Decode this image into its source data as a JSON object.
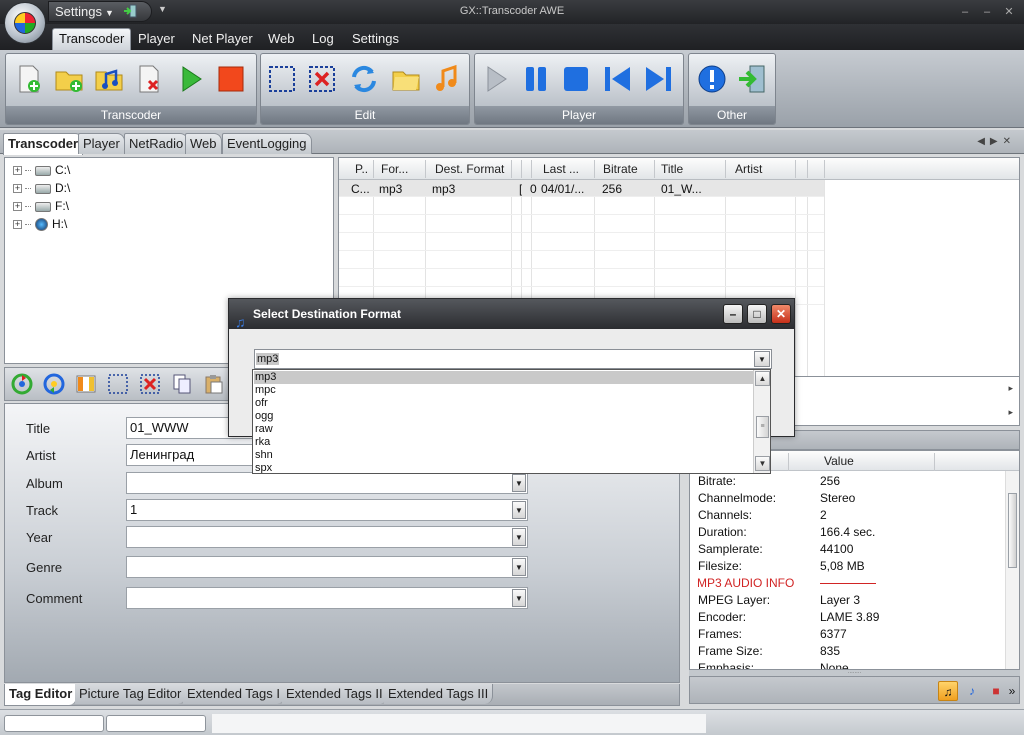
{
  "window": {
    "title": "GX::Transcoder AWE",
    "settings_label": "Settings",
    "win_buttons": [
      "–",
      "–",
      "✕"
    ]
  },
  "menu": [
    {
      "label": "Transcoder",
      "active": true
    },
    {
      "label": "Player",
      "active": false
    },
    {
      "label": "Net Player",
      "active": false
    },
    {
      "label": "Web",
      "active": false
    },
    {
      "label": "Log",
      "active": false
    },
    {
      "label": "Settings",
      "active": false
    }
  ],
  "ribbon": {
    "groups": [
      "Transcoder",
      "Edit",
      "Player",
      "Other"
    ]
  },
  "doc_tabs": [
    {
      "label": "Transcoder",
      "active": true
    },
    {
      "label": "Player",
      "active": false
    },
    {
      "label": "NetRadio",
      "active": false
    },
    {
      "label": "Web",
      "active": false
    },
    {
      "label": "EventLogging",
      "active": false
    }
  ],
  "tree": {
    "drives": [
      "C:\\",
      "D:\\",
      "F:\\",
      "H:\\"
    ]
  },
  "job_grid": {
    "columns": [
      "P..",
      "For...",
      "Dest. Format",
      "Last ...",
      "Bitrate",
      "Title",
      "Artist"
    ],
    "row": {
      "p": "C...",
      "format": "mp3",
      "dest_format": "mp3",
      "c1": "[",
      "c2": "0",
      "last": "04/01/...",
      "bitrate": "256",
      "title": "01_W..."
    }
  },
  "dialog": {
    "title": "Select Destination Format",
    "selected": "mp3",
    "options": [
      "mp3",
      "mpc",
      "ofr",
      "ogg",
      "raw",
      "rka",
      "shn",
      "spx"
    ],
    "thumb_mark": "≡"
  },
  "tag_editor": {
    "fields": [
      {
        "label": "Title",
        "value": "01_WWW"
      },
      {
        "label": "Artist",
        "value": "Ленинград"
      },
      {
        "label": "Album",
        "value": ""
      },
      {
        "label": "Track",
        "value": "1"
      },
      {
        "label": "Year",
        "value": ""
      },
      {
        "label": "Genre",
        "value": ""
      },
      {
        "label": "Comment",
        "value": ""
      }
    ],
    "tabs": [
      {
        "label": "Tag Editor",
        "active": true
      },
      {
        "label": "Picture Tag Editor",
        "active": false
      },
      {
        "label": "Extended Tags I",
        "active": false
      },
      {
        "label": "Extended Tags II",
        "active": false
      },
      {
        "label": "Extended Tags III",
        "active": false
      }
    ]
  },
  "properties": {
    "value_header": "Value",
    "rows": [
      {
        "name": "Bitrate:",
        "value": "256"
      },
      {
        "name": "Channelmode:",
        "value": "Stereo"
      },
      {
        "name": "Channels:",
        "value": "2"
      },
      {
        "name": "Duration:",
        "value": "166.4 sec."
      },
      {
        "name": "Samplerate:",
        "value": "44100"
      },
      {
        "name": "Filesize:",
        "value": "5,08 MB"
      },
      {
        "name": "MP3 AUDIO INFO",
        "value": "",
        "section": true
      },
      {
        "name": "MPEG Layer:",
        "value": "Layer 3"
      },
      {
        "name": "Encoder:",
        "value": "LAME 3.89"
      },
      {
        "name": "Frames:",
        "value": "6377"
      },
      {
        "name": "Frame Size:",
        "value": "835"
      },
      {
        "name": "Emphasis:",
        "value": "None"
      }
    ]
  },
  "colors": {
    "accent": "#d12424",
    "ribbon_label": "#6f7781",
    "dialog_close": "#c6301a"
  }
}
